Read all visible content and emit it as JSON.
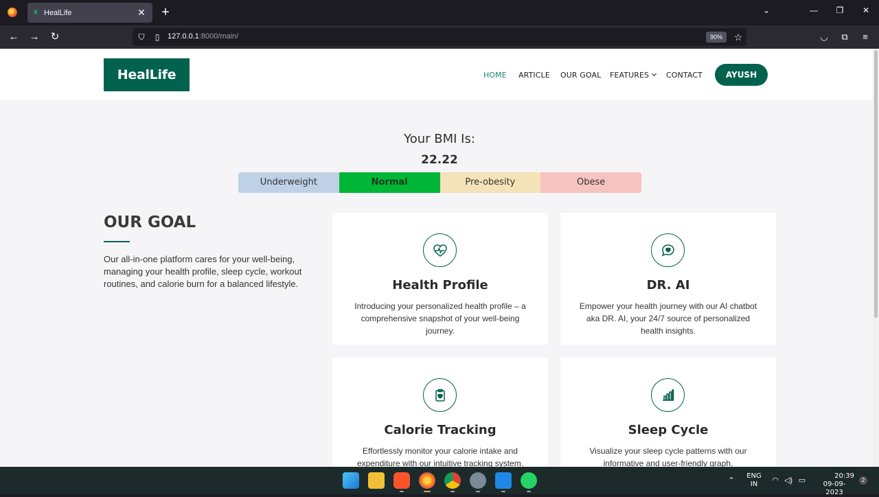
{
  "browser": {
    "tab_title": "HealLife",
    "tab_close": "✕",
    "new_tab": "+",
    "url_host": "127.0.0.1",
    "url_path": ":8000/main/",
    "zoom": "90%",
    "window_controls": {
      "list_tabs": "⌄",
      "minimize": "—",
      "restore": "❐",
      "close": "✕"
    }
  },
  "site": {
    "logo": "HealLife",
    "menu": {
      "home": "HOME",
      "article": "ARTICLE",
      "our_goal": "OUR GOAL",
      "features": "FEATURES",
      "contact": "CONTACT"
    },
    "user_button": "AYUSH"
  },
  "bmi": {
    "title": "Your BMI Is:",
    "value": "22.22",
    "categories": [
      {
        "label": "Underweight",
        "color": "#bfd1e6"
      },
      {
        "label": "Normal",
        "color": "#00b636",
        "active": true
      },
      {
        "label": "Pre-obesity",
        "color": "#f4e3b8"
      },
      {
        "label": "Obese",
        "color": "#f6c3c1"
      }
    ]
  },
  "goal": {
    "heading": "OUR GOAL",
    "text": "Our all-in-one platform cares for your well-being, managing your health profile, sleep cycle, workout routines, and calorie burn for a balanced lifestyle."
  },
  "cards": [
    {
      "icon": "heart-pulse-icon",
      "title": "Health Profile",
      "desc": "Introducing your personalized health profile – a comprehensive snapshot of your well-being journey."
    },
    {
      "icon": "chat-heart-icon",
      "title": "DR. AI",
      "desc": "Empower your health journey with our AI chatbot aka DR. AI, your 24/7 source of personalized health insights."
    },
    {
      "icon": "clipboard-heart-icon",
      "title": "Calorie Tracking",
      "desc": "Effortlessly monitor your calorie intake and expenditure with our intuitive tracking system."
    },
    {
      "icon": "bar-chart-icon",
      "title": "Sleep Cycle",
      "desc": "Visualize your sleep cycle patterns with our informative and user-friendly graph."
    }
  ],
  "taskbar": {
    "lang_top": "ENG",
    "lang_bottom": "IN",
    "time": "20:39",
    "date": "09-09-2023",
    "notifications": "2"
  },
  "colors": {
    "brand": "#02624e",
    "active_menu": "#1b8a74"
  }
}
